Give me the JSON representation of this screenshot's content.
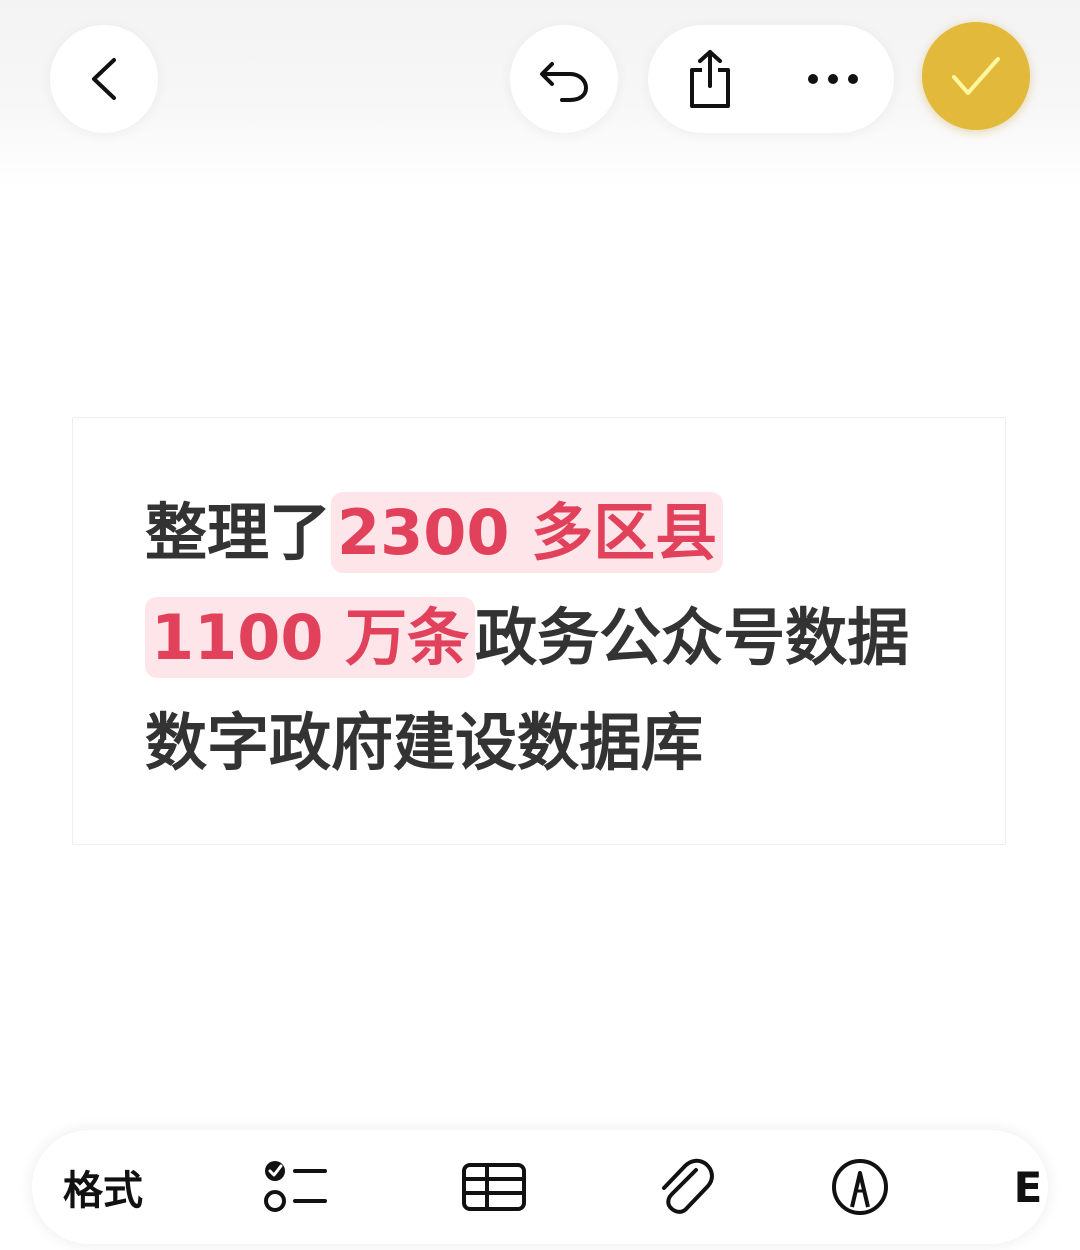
{
  "toolbar": {
    "back_icon": "chevron-left-icon",
    "undo_icon": "undo-icon",
    "share_icon": "share-icon",
    "more_icon": "ellipsis-icon",
    "done_icon": "checkmark-icon",
    "done_color": "#e2b93a"
  },
  "note": {
    "line1_prefix": "整理了",
    "line1_highlight": "2300 多区县",
    "line2_highlight": "1100 万条",
    "line2_suffix": "政务公众号数据",
    "line3": "数字政府建设数据库",
    "highlight_color": "#e2415b",
    "highlight_bg": "#fde5e9",
    "text_color": "#333333"
  },
  "bottom_toolbar": {
    "format_label": "格式",
    "checklist_icon": "checklist-icon",
    "table_icon": "table-icon",
    "attachment_icon": "paperclip-icon",
    "markup_icon": "pen-circle-icon",
    "edge_glyph": "E"
  }
}
